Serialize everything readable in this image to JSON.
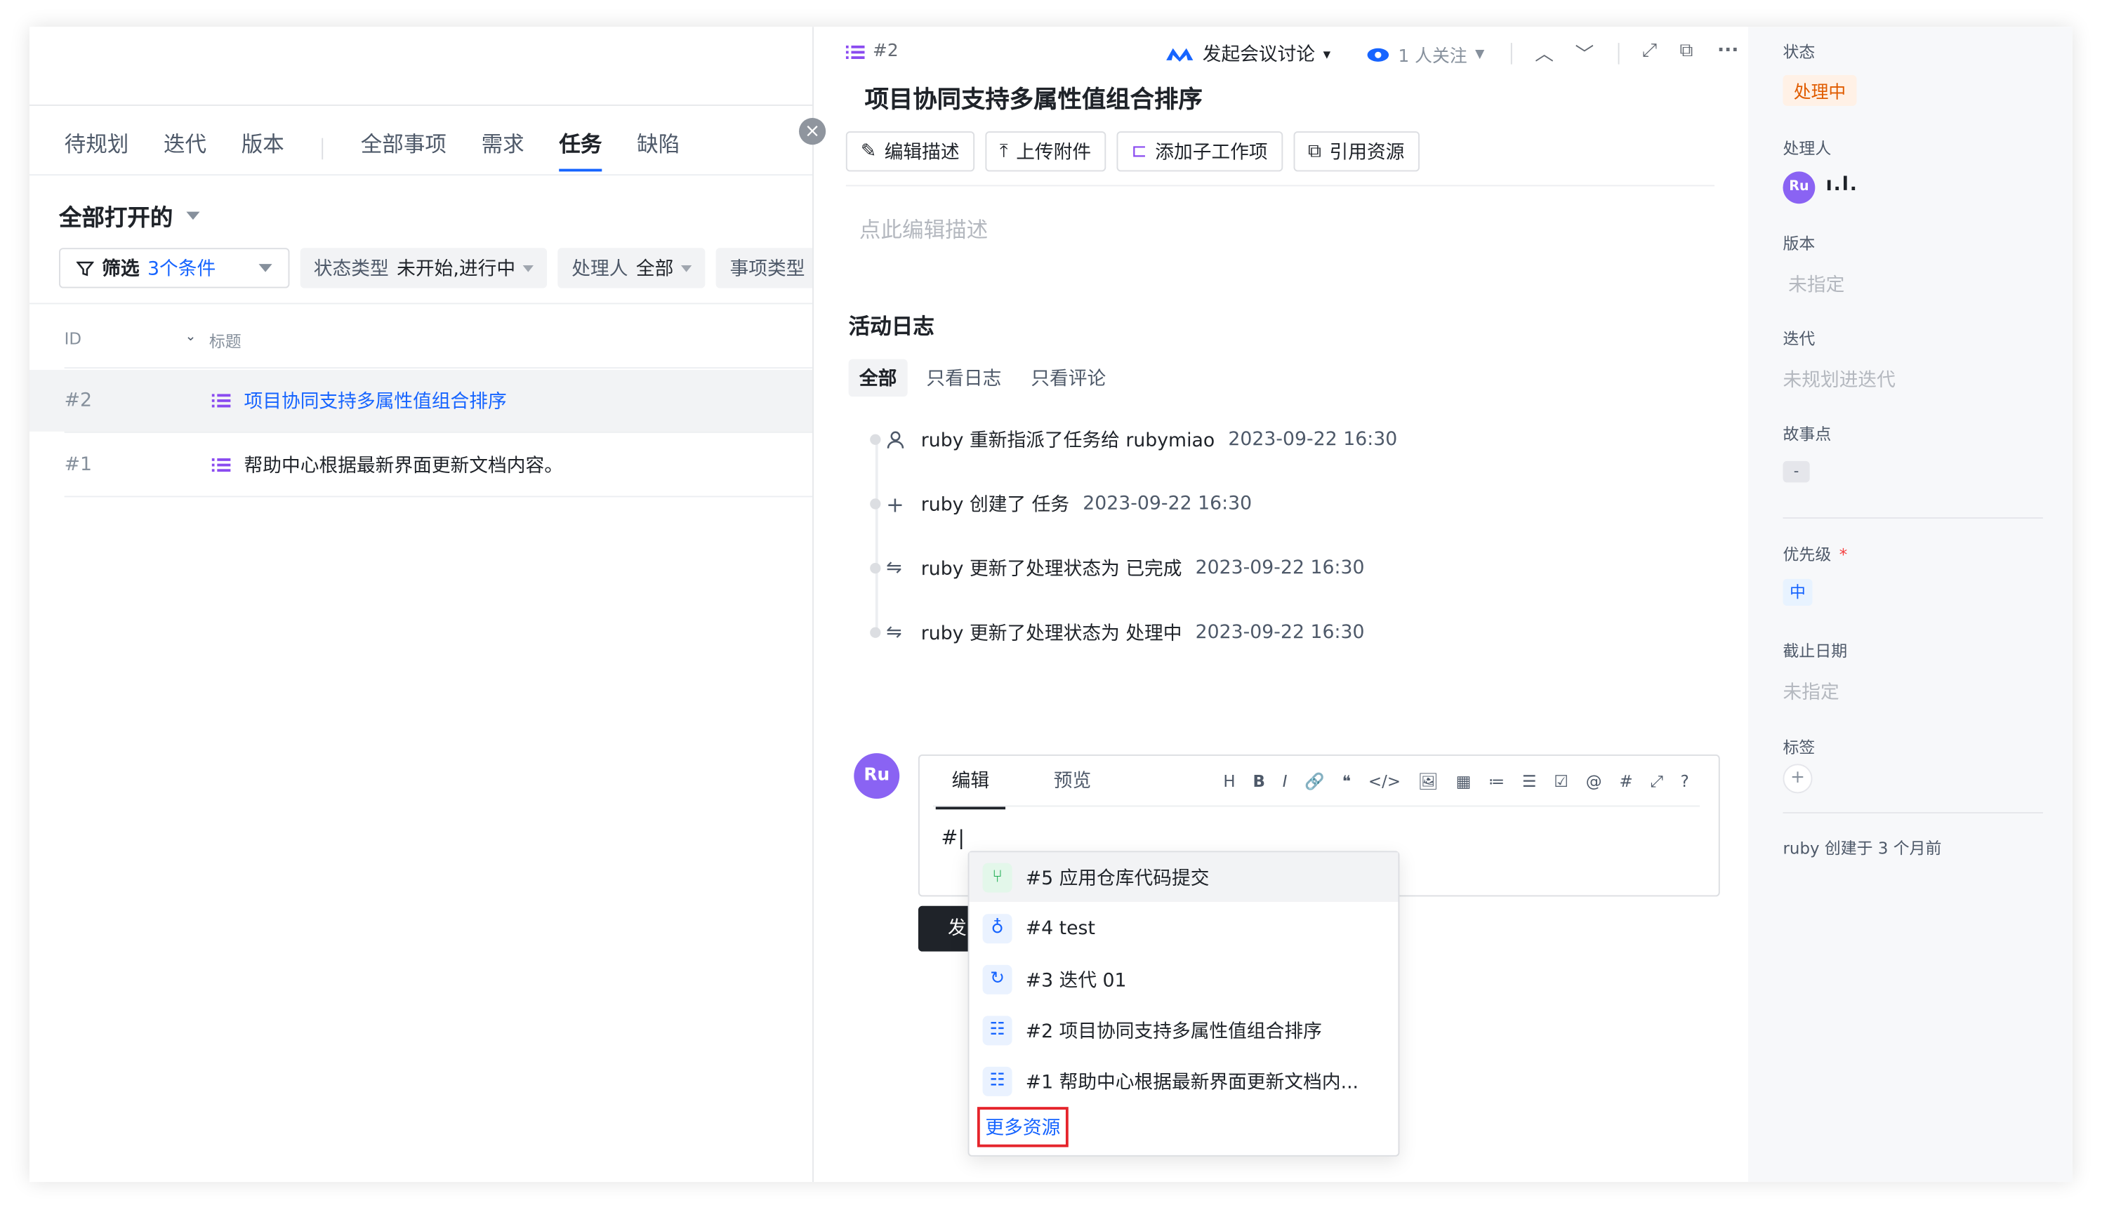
{
  "left": {
    "tabs": [
      "待规划",
      "迭代",
      "版本",
      "全部事项",
      "需求",
      "任务",
      "缺陷"
    ],
    "view_title": "全部打开的",
    "filter": {
      "label": "筛选",
      "count": "3个条件"
    },
    "chips": [
      {
        "label": "状态类型",
        "value": "未开始,进行中"
      },
      {
        "label": "处理人",
        "value": "全部"
      },
      {
        "label": "事项类型",
        "value": ""
      }
    ],
    "columns": {
      "id": "ID",
      "title": "标题"
    },
    "rows": [
      {
        "id": "#2",
        "title": "项目协同支持多属性值组合排序"
      },
      {
        "id": "#1",
        "title": "帮助中心根据最新界面更新文档内容。"
      }
    ]
  },
  "detail": {
    "item_id": "#2",
    "meeting": "发起会议讨论",
    "followers": "1 人关注",
    "title": "项目协同支持多属性值组合排序",
    "actions": [
      "编辑描述",
      "上传附件",
      "添加子工作项",
      "引用资源"
    ],
    "description_placeholder": "点此编辑描述",
    "activity_heading": "活动日志",
    "activity_tabs": [
      "全部",
      "只看日志",
      "只看评论"
    ],
    "logs": [
      {
        "icon": "user-icon",
        "text": "ruby 重新指派了任务给  rubymiao",
        "time": "2023-09-22 16:30"
      },
      {
        "icon": "plus-icon",
        "text": "ruby 创建了 任务",
        "time": "2023-09-22 16:30"
      },
      {
        "icon": "swap-icon",
        "text": "ruby 更新了处理状态为  已完成",
        "time": "2023-09-22 16:30"
      },
      {
        "icon": "swap-icon",
        "text": "ruby 更新了处理状态为  处理中",
        "time": "2023-09-22 16:30"
      }
    ],
    "comment_avatar": "Ru",
    "editor_tabs": [
      "编辑",
      "预览"
    ],
    "editor_tools": [
      "H",
      "B",
      "I",
      "🔗",
      "❝",
      "</>",
      "🖼",
      "▦",
      "≔",
      "☰",
      "☑",
      "@",
      "#",
      "⤢",
      "?"
    ],
    "editor_text": "#|",
    "send_label": "发",
    "popup": {
      "items": [
        {
          "icon": "merge-request-icon",
          "text": "#5 应用仓库代码提交"
        },
        {
          "icon": "bulb-icon",
          "text": "#4 test"
        },
        {
          "icon": "iteration-icon",
          "text": "#3 迭代 01"
        },
        {
          "icon": "task-list-icon",
          "text": "#2 项目协同支持多属性值组合排序"
        },
        {
          "icon": "task-list-icon",
          "text": "#1 帮助中心根据最新界面更新文档内..."
        }
      ],
      "more": "更多资源"
    }
  },
  "side": {
    "status_label": "状态",
    "status_value": "处理中",
    "assignee_label": "处理人",
    "assignee_avatar": "Ru",
    "assignee_name": "ı.l.",
    "version_label": "版本",
    "version_value": "未指定",
    "iteration_label": "迭代",
    "iteration_value": "未规划进迭代",
    "points_label": "故事点",
    "points_value": "-",
    "priority_label": "优先级",
    "priority_required": "*",
    "priority_value": "中",
    "due_label": "截止日期",
    "due_value": "未指定",
    "tags_label": "标签",
    "created": "ruby 创建于 3 个月前"
  },
  "colors": {
    "accent": "#1664ff",
    "status_orange": "#e05c00",
    "avatar_purple": "#8a63f3",
    "highlight_red": "#e5242b"
  }
}
